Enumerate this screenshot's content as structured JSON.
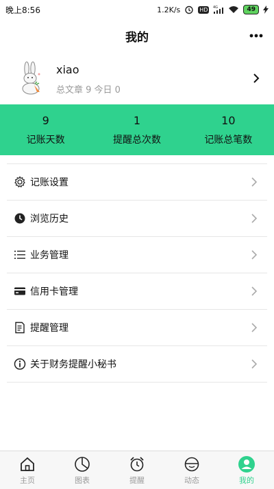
{
  "status_bar": {
    "time": "晚上8:56",
    "speed": "1.2K/s",
    "hd": "HD",
    "network": "4G",
    "battery": "49"
  },
  "header": {
    "title": "我的"
  },
  "profile": {
    "username": "xiao",
    "stats_line": "总文章 9 今日 0"
  },
  "summary": [
    {
      "value": "9",
      "label": "记账天数"
    },
    {
      "value": "1",
      "label": "提醒总次数"
    },
    {
      "value": "10",
      "label": "记账总笔数"
    }
  ],
  "menu": [
    {
      "label": "记账设置",
      "icon": "gear-icon"
    },
    {
      "label": "浏览历史",
      "icon": "clock-icon"
    },
    {
      "label": "业务管理",
      "icon": "list-icon"
    },
    {
      "label": "信用卡管理",
      "icon": "credit-card-icon"
    },
    {
      "label": "提醒管理",
      "icon": "document-icon"
    },
    {
      "label": "关于财务提醒小秘书",
      "icon": "info-icon"
    }
  ],
  "tabs": [
    {
      "label": "主页",
      "icon": "home-icon",
      "active": false
    },
    {
      "label": "图表",
      "icon": "pie-chart-icon",
      "active": false
    },
    {
      "label": "提醒",
      "icon": "alarm-clock-icon",
      "active": false
    },
    {
      "label": "动态",
      "icon": "feed-icon",
      "active": false
    },
    {
      "label": "我的",
      "icon": "user-icon",
      "active": true
    }
  ],
  "colors": {
    "accent": "#2fd28e",
    "inactive_tab": "#9a9a9a"
  }
}
